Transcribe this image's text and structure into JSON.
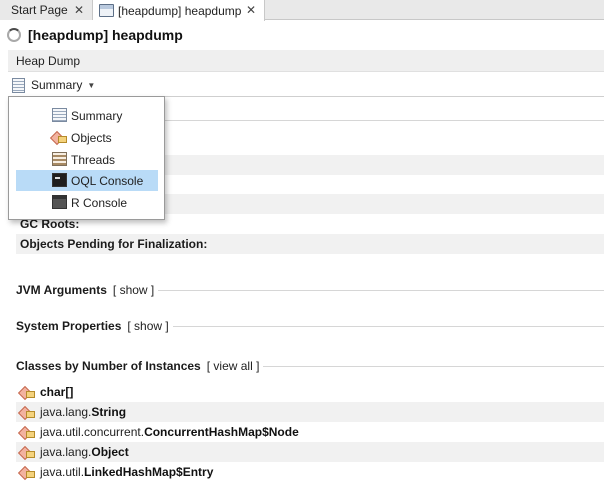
{
  "tabs": [
    {
      "label": "Start Page",
      "close": "✕"
    },
    {
      "label": "[heapdump] heapdump",
      "close": "✕"
    }
  ],
  "title": "[heapdump] heapdump",
  "view_label": "Heap Dump",
  "view_selector": {
    "label": "Summary",
    "caret": "▼"
  },
  "menu": {
    "items": [
      {
        "label": "Summary",
        "icon": "summary-icon",
        "selected": false
      },
      {
        "label": "Objects",
        "icon": "objects-icon",
        "selected": false
      },
      {
        "label": "Threads",
        "icon": "threads-icon",
        "selected": false
      },
      {
        "label": "OQL Console",
        "icon": "oql-console-icon",
        "selected": true
      },
      {
        "label": "R Console",
        "icon": "r-console-icon",
        "selected": false
      }
    ]
  },
  "summary_rows": {
    "gc_roots": "GC Roots:",
    "pending_finalization": "Objects Pending for Finalization:"
  },
  "sections": {
    "jvm_arguments": {
      "label": "JVM Arguments",
      "link": "[ show ]"
    },
    "system_properties": {
      "label": "System Properties",
      "link": "[ show ]"
    },
    "classes_by_instances": {
      "label": "Classes by Number of Instances",
      "link": "[ view all ]"
    }
  },
  "classes": [
    {
      "package": "",
      "name": "char[]"
    },
    {
      "package": "java.lang.",
      "name": "String"
    },
    {
      "package": "java.util.concurrent.",
      "name": "ConcurrentHashMap$Node"
    },
    {
      "package": "java.lang.",
      "name": "Object"
    },
    {
      "package": "java.util.",
      "name": "LinkedHashMap$Entry"
    }
  ],
  "colors": {
    "selection": "#b9dbf7",
    "shade": "#f1f1f1"
  }
}
